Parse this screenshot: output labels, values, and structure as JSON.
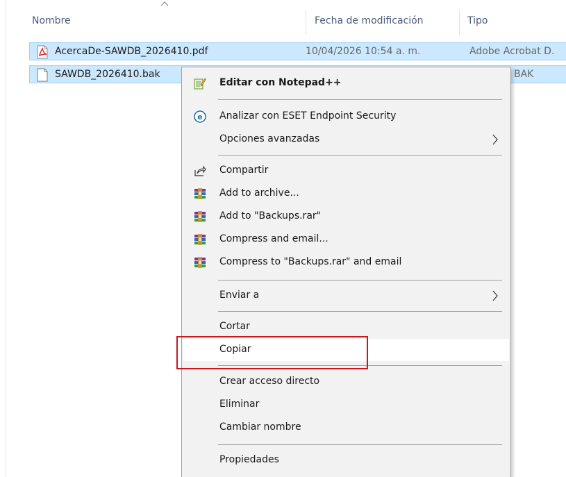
{
  "columns": {
    "name": "Nombre",
    "date": "Fecha de modificación",
    "type": "Tipo"
  },
  "files": [
    {
      "name": "AcercaDe-SAWDB_2026410.pdf",
      "date": "10/04/2026 10:54 a. m.",
      "type": "Adobe Acrobat D.",
      "icon": "pdf-file-icon"
    },
    {
      "name": "SAWDB_2026410.bak",
      "date": "",
      "type": "BAK",
      "icon": "blank-file-icon"
    }
  ],
  "menu": {
    "notepad": "Editar con Notepad++",
    "eset": "Analizar con ESET Endpoint Security",
    "advanced": "Opciones avanzadas",
    "share": "Compartir",
    "add_archive": "Add to archive...",
    "add_rar": "Add to \"Backups.rar\"",
    "compress_email": "Compress and email...",
    "compress_rar_email": "Compress to \"Backups.rar\" and email",
    "send_to": "Enviar a",
    "cut": "Cortar",
    "copy": "Copiar",
    "shortcut": "Crear acceso directo",
    "delete": "Eliminar",
    "rename": "Cambiar nombre",
    "properties": "Propiedades"
  },
  "colors": {
    "selection": "#cce8ff",
    "highlight_box": "#c8161d",
    "menu_bg": "#f2f2f2"
  }
}
